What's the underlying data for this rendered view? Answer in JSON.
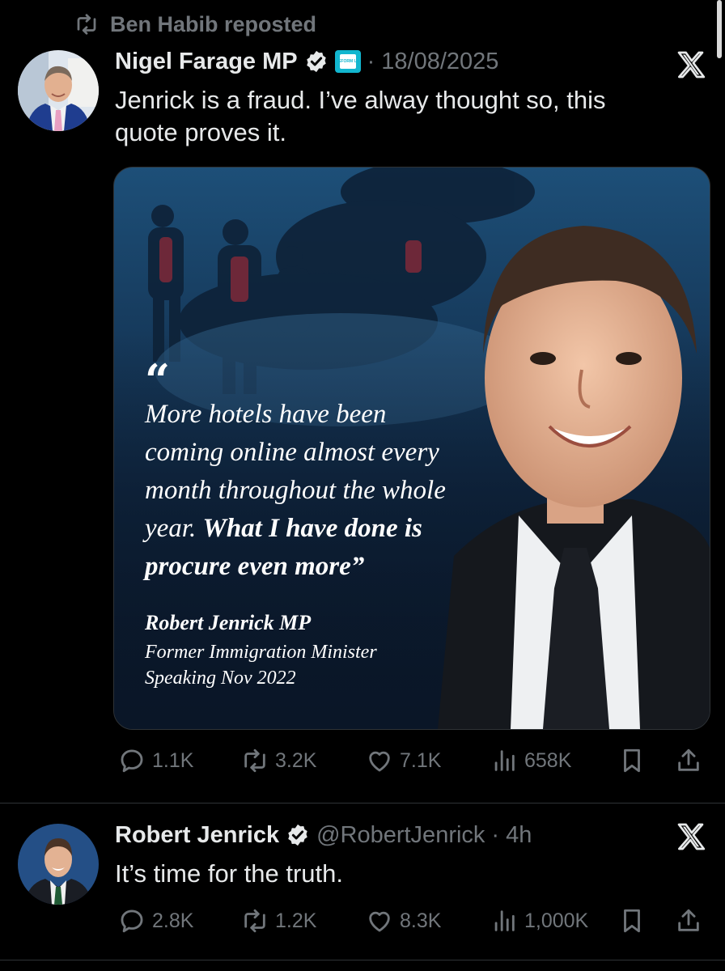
{
  "repost": {
    "text": "Ben Habib reposted"
  },
  "tweet1": {
    "display_name": "Nigel Farage MP",
    "affiliation_badge": "REFORM UK",
    "separator": "·",
    "timestamp": "18/08/2025",
    "text_line1": "Jenrick is a fraud. I’ve alway thought so, this",
    "text_line2": "quote proves it.",
    "media": {
      "quote_mark": "“",
      "quote_line1": "More hotels have been",
      "quote_line2": "coming online almost every",
      "quote_line3": "month throughout the whole",
      "quote_line4_plain": "year. ",
      "quote_line4_bold": "What I have done is",
      "quote_line5_bold": "procure even more",
      "quote_close": "”",
      "attribution_name": "Robert Jenrick MP",
      "attribution_role": "Former Immigration Minister",
      "attribution_date": "Speaking Nov 2022"
    },
    "actions": {
      "replies": "1.1K",
      "reposts": "3.2K",
      "likes": "7.1K",
      "views": "658K"
    }
  },
  "tweet2": {
    "display_name": "Robert Jenrick",
    "handle": "@RobertJenrick",
    "separator": "·",
    "timestamp": "4h",
    "text": "It’s time for the truth.",
    "actions": {
      "replies": "2.8K",
      "reposts": "1.2K",
      "likes": "8.3K",
      "views": "1,000K"
    }
  },
  "icons": {
    "repost": "repost-icon",
    "verified": "verified-badge-icon",
    "x_logo": "x-logo-icon",
    "reply": "reply-icon",
    "like": "heart-icon",
    "views": "views-icon",
    "bookmark": "bookmark-icon",
    "share": "share-icon"
  },
  "colors": {
    "background": "#000000",
    "text": "#e7e9ea",
    "secondary": "#71767b",
    "verified": "#e7e9ea",
    "affiliation": "#12b6cf",
    "divider": "#2f3336"
  }
}
